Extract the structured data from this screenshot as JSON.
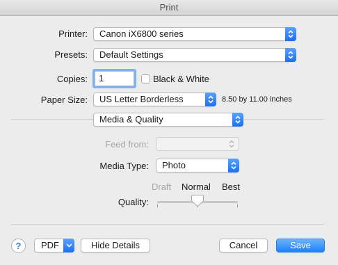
{
  "window": {
    "title": "Print"
  },
  "printer": {
    "label": "Printer:",
    "value": "Canon iX6800 series"
  },
  "presets": {
    "label": "Presets:",
    "value": "Default Settings"
  },
  "copies": {
    "label": "Copies:",
    "value": "1",
    "bw_label": "Black & White",
    "bw_checked": false
  },
  "paper": {
    "label": "Paper Size:",
    "value": "US Letter Borderless",
    "dimensions": "8.50 by 11.00 inches"
  },
  "section": {
    "value": "Media & Quality"
  },
  "feed": {
    "label": "Feed from:",
    "value": ""
  },
  "media": {
    "label": "Media Type:",
    "value": "Photo"
  },
  "quality": {
    "label": "Quality:",
    "levels": [
      "Draft",
      "Normal",
      "Best"
    ],
    "selected": "Normal"
  },
  "footer": {
    "help_glyph": "?",
    "pdf_label": "PDF",
    "hide_details_label": "Hide Details",
    "cancel_label": "Cancel",
    "save_label": "Save"
  },
  "colors": {
    "accent": "#1b6ff5",
    "focus_ring": "#7fb2f5"
  }
}
